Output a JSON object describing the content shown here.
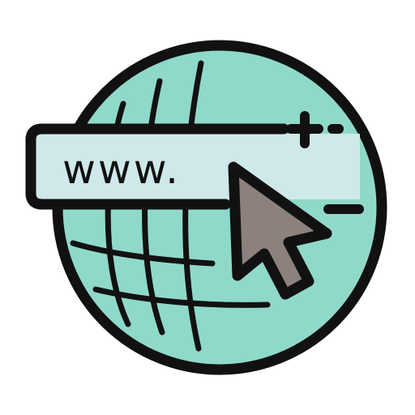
{
  "icon": {
    "name": "web-address-icon",
    "url_text": "www.",
    "colors": {
      "globe_fill": "#8fd9ca",
      "address_bar_fill": "#cfe9ea",
      "cursor_fill": "#8c817c",
      "outline": "#111111",
      "background": "#ffffff"
    }
  }
}
